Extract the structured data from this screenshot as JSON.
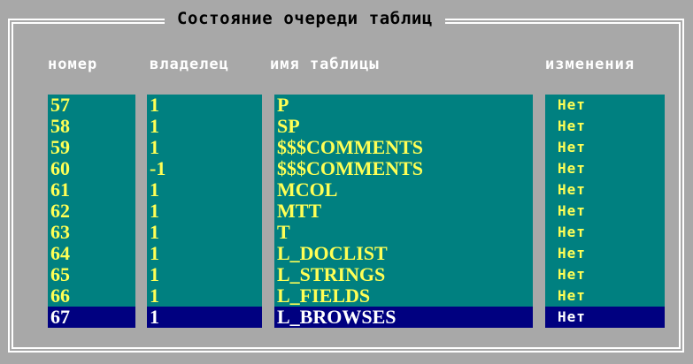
{
  "title": "Состояние очереди таблиц",
  "headers": {
    "number": "номер",
    "owner": "владелец",
    "table_name": "имя таблицы",
    "changes": "изменения"
  },
  "rows": [
    {
      "number": "57",
      "owner": "1",
      "name": "P",
      "changes": "Нет"
    },
    {
      "number": "58",
      "owner": "1",
      "name": "SP",
      "changes": "Нет"
    },
    {
      "number": "59",
      "owner": "1",
      "name": "$$$COMMENTS",
      "changes": "Нет"
    },
    {
      "number": "60",
      "owner": "-1",
      "name": "$$$COMMENTS",
      "changes": "Нет"
    },
    {
      "number": "61",
      "owner": "1",
      "name": "MCOL",
      "changes": "Нет"
    },
    {
      "number": "62",
      "owner": "1",
      "name": "MTT",
      "changes": "Нет"
    },
    {
      "number": "63",
      "owner": "1",
      "name": "T",
      "changes": "Нет"
    },
    {
      "number": "64",
      "owner": "1",
      "name": "L_DOCLIST",
      "changes": "Нет"
    },
    {
      "number": "65",
      "owner": "1",
      "name": "L_STRINGS",
      "changes": "Нет"
    },
    {
      "number": "66",
      "owner": "1",
      "name": "L_FIELDS",
      "changes": "Нет"
    },
    {
      "number": "67",
      "owner": "1",
      "name": "L_BROWSES",
      "changes": "Нет"
    }
  ],
  "selected_index": 10,
  "colors": {
    "background": "#a8a8a8",
    "column_bg": "#008080",
    "cell_text": "#ffff55",
    "selected_bg": "#000080",
    "selected_text": "#ffffff"
  }
}
